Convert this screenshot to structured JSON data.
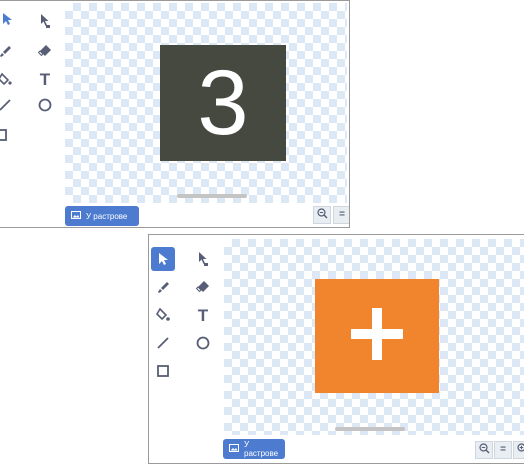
{
  "top_editor": {
    "tools": [
      {
        "name": "select-tool",
        "icon": "arrow-pointer-icon"
      },
      {
        "name": "reshape-tool",
        "icon": "reshape-pointer-icon"
      },
      {
        "name": "brush-tool",
        "icon": "brush-icon"
      },
      {
        "name": "eraser-tool",
        "icon": "eraser-icon"
      },
      {
        "name": "fill-tool",
        "icon": "fill-bucket-icon"
      },
      {
        "name": "text-tool",
        "icon": "text-icon",
        "label": "T"
      },
      {
        "name": "line-tool",
        "icon": "line-icon"
      },
      {
        "name": "circle-tool",
        "icon": "circle-icon"
      },
      {
        "name": "rectangle-tool",
        "icon": "rectangle-icon"
      }
    ],
    "costume": {
      "text": "3",
      "background": "#46493f",
      "foreground": "#ffffff"
    },
    "convert_button_label": "У растрове",
    "zoom": [
      "zoom-out",
      "zoom-reset"
    ]
  },
  "bottom_editor": {
    "tools": [
      {
        "name": "select-tool",
        "icon": "arrow-pointer-icon",
        "selected": true
      },
      {
        "name": "reshape-tool",
        "icon": "reshape-pointer-icon"
      },
      {
        "name": "brush-tool",
        "icon": "brush-icon"
      },
      {
        "name": "eraser-tool",
        "icon": "eraser-icon"
      },
      {
        "name": "fill-tool",
        "icon": "fill-bucket-icon"
      },
      {
        "name": "text-tool",
        "icon": "text-icon",
        "label": "T"
      },
      {
        "name": "line-tool",
        "icon": "line-icon"
      },
      {
        "name": "circle-tool",
        "icon": "circle-icon"
      },
      {
        "name": "rectangle-tool",
        "icon": "rectangle-icon"
      }
    ],
    "costume": {
      "symbol": "plus",
      "background": "#f0852e",
      "foreground": "#ffffff"
    },
    "convert_button_label": "У растрове",
    "zoom": [
      "zoom-out",
      "zoom-reset",
      "zoom-in"
    ]
  },
  "colors": {
    "accent": "#4c7bd0",
    "icon": "#575e75",
    "checker": "#dde8f6"
  }
}
